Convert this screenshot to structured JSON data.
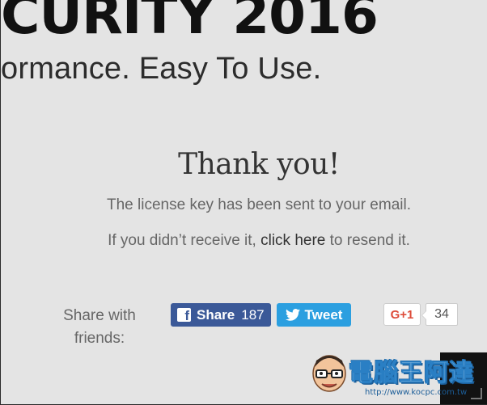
{
  "hero": {
    "title": "CURITY 2016",
    "tagline": "ormance. Easy To Use."
  },
  "confirmation": {
    "heading": "Thank you!",
    "message": "The license key has been sent to your email.",
    "resend_prefix": "If you didn’t receive it, ",
    "resend_link": "click here",
    "resend_suffix": " to resend it."
  },
  "share": {
    "label_line1": "Share with",
    "label_line2": "friends:",
    "facebook": {
      "label": "Share",
      "count": "187",
      "icon": "facebook-icon",
      "color": "#3b5998"
    },
    "twitter": {
      "label": "Tweet",
      "icon": "twitter-bird-icon",
      "color": "#2b9fe0"
    },
    "gplus": {
      "label": "G+1",
      "count": "34",
      "color": "#dd4b39"
    }
  },
  "watermark": {
    "text": "電腦王阿達",
    "url": "http://www.kocpc.com.tw"
  }
}
